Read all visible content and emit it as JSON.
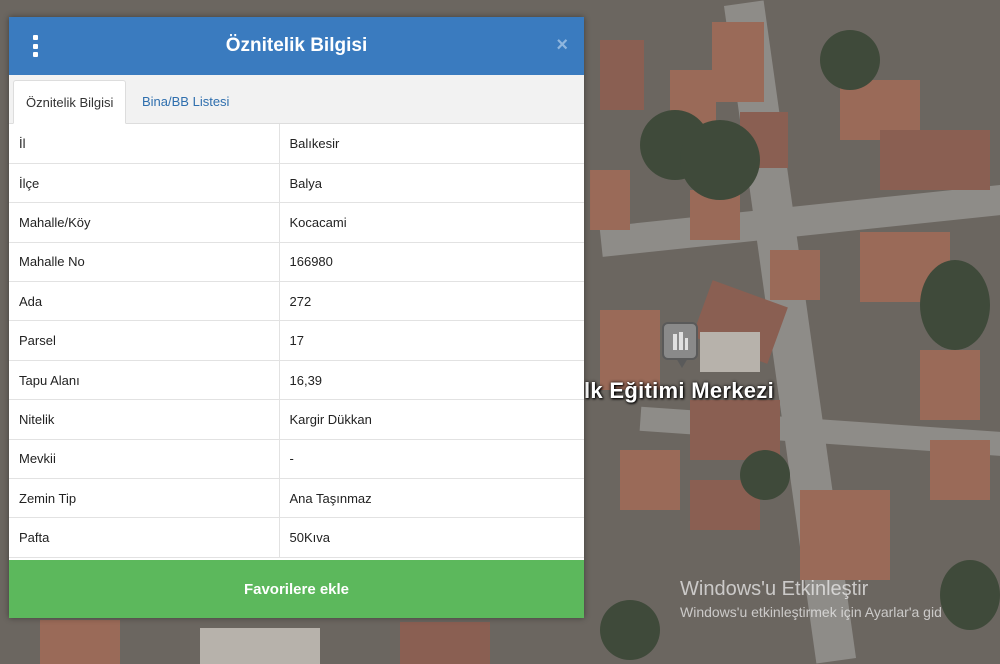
{
  "map": {
    "place_label": "lk Eğitimi Merkezi",
    "watermark_title": "Windows'u Etkinleştir",
    "watermark_sub": "Windows'u etkinleştirmek için Ayarlar'a gid"
  },
  "panel": {
    "title": "Öznitelik Bilgisi",
    "close_icon": "×",
    "tabs": [
      {
        "label": "Öznitelik Bilgisi",
        "active": true
      },
      {
        "label": "Bina/BB Listesi",
        "active": false
      }
    ],
    "rows": [
      {
        "key": "İl",
        "value": "Balıkesir"
      },
      {
        "key": "İlçe",
        "value": "Balya"
      },
      {
        "key": "Mahalle/Köy",
        "value": "Kocacami"
      },
      {
        "key": "Mahalle No",
        "value": "166980"
      },
      {
        "key": "Ada",
        "value": "272"
      },
      {
        "key": "Parsel",
        "value": "17"
      },
      {
        "key": "Tapu Alanı",
        "value": "16,39"
      },
      {
        "key": "Nitelik",
        "value": "Kargir Dükkan"
      },
      {
        "key": "Mevkii",
        "value": "-"
      },
      {
        "key": "Zemin Tip",
        "value": "Ana Taşınmaz"
      },
      {
        "key": "Pafta",
        "value": "50Kıva"
      }
    ],
    "favorite_button": "Favorilere ekle"
  },
  "colors": {
    "header": "#3a7bbf",
    "tab_link": "#2f6fae",
    "favorite_button": "#5cb85c"
  }
}
